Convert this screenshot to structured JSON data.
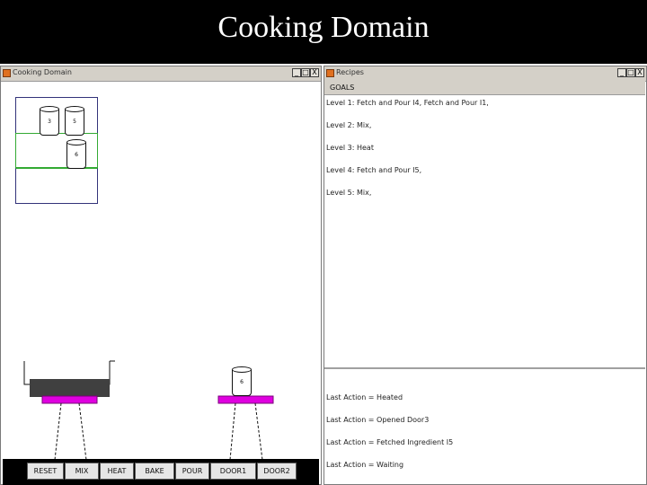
{
  "slide": {
    "title": "Cooking Domain"
  },
  "cooking_window": {
    "title": "Cooking Domain",
    "controls": [
      "_",
      "□",
      "X"
    ],
    "jars": [
      "3",
      "5",
      "6"
    ],
    "stove_jar": "6",
    "buttons": [
      "RESET",
      "MIX",
      "HEAT",
      "BAKE",
      "POUR",
      "DOOR1",
      "DOOR2"
    ]
  },
  "recipes_window": {
    "title": "Recipes",
    "controls": [
      "_",
      "□",
      "X"
    ],
    "goals_label": "GOALS",
    "goals": [
      "Level 1: Fetch and Pour I4, Fetch and Pour I1,",
      "Level 2: Mix,",
      "Level 3: Heat",
      "Level 4: Fetch and Pour I5,",
      "Level 5: Mix,"
    ],
    "status": [
      "Last Action = Heated",
      "Last Action = Opened Door3",
      "Last Action = Fetched Ingredient I5",
      "Last Action = Waiting"
    ]
  },
  "colors": {
    "burner": "#e000e0",
    "pot": "#404040",
    "shelf_highlight": "#33aa33",
    "bottom_bar": "#000000"
  }
}
